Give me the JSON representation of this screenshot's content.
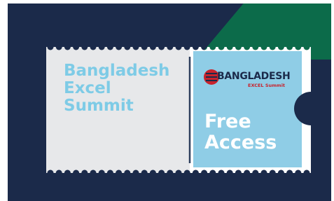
{
  "ticket": {
    "left_title_lines": [
      "Bangladesh",
      "Excel",
      "Summit"
    ],
    "logo": {
      "brand_text": "BANGLADESH",
      "sub_text": "EXCEL Summit"
    },
    "access_lines": [
      "Free",
      "Access"
    ]
  },
  "colors": {
    "background_navy": "#1b2a4a",
    "corner_green": "#0c6b4a",
    "ticket_left": "#e7e8ea",
    "ticket_right": "#8fcde6",
    "title_blue": "#7ecbe6",
    "logo_red": "#c8232c"
  }
}
